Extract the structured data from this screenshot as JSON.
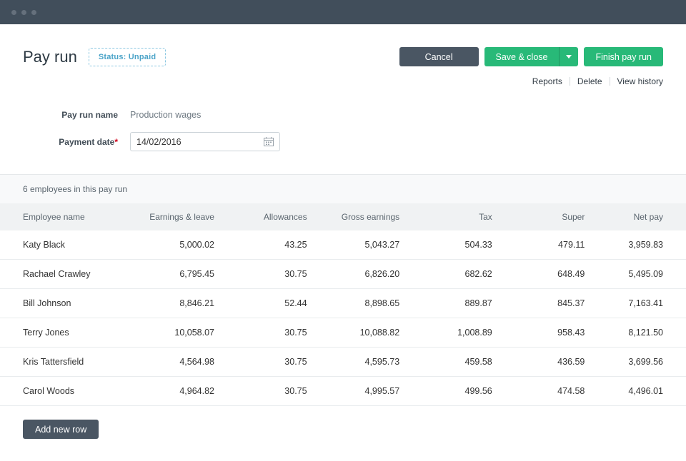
{
  "colors": {
    "topbar": "#414e5b",
    "dot": "#65707c",
    "dark_button": "#4a5663",
    "green": "#28b978",
    "badge_text": "#4aa3c8",
    "badge_border": "#8cc8e1",
    "link": "#333d46",
    "red": "#d0021b",
    "table_header_bg": "#f0f2f3"
  },
  "header": {
    "title": "Pay run",
    "status_badge": "Status: Unpaid",
    "buttons": {
      "cancel": "Cancel",
      "save_close": "Save & close",
      "finish": "Finish pay run"
    },
    "links": [
      "Reports",
      "Delete",
      "View history"
    ]
  },
  "form": {
    "name_label": "Pay run name",
    "name_value": "Production wages",
    "date_label": "Payment date",
    "required_marker": "*",
    "date_value": "14/02/2016"
  },
  "table": {
    "summary": "6 employees in this pay run",
    "columns": [
      "Employee name",
      "Earnings & leave",
      "Allowances",
      "Gross earnings",
      "Tax",
      "Super",
      "Net pay"
    ],
    "rows": [
      [
        "Katy Black",
        "5,000.02",
        "43.25",
        "5,043.27",
        "504.33",
        "479.11",
        "3,959.83"
      ],
      [
        "Rachael Crawley",
        "6,795.45",
        "30.75",
        "6,826.20",
        "682.62",
        "648.49",
        "5,495.09"
      ],
      [
        "Bill Johnson",
        "8,846.21",
        "52.44",
        "8,898.65",
        "889.87",
        "845.37",
        "7,163.41"
      ],
      [
        "Terry Jones",
        "10,058.07",
        "30.75",
        "10,088.82",
        "1,008.89",
        "958.43",
        "8,121.50"
      ],
      [
        "Kris Tattersfield",
        "4,564.98",
        "30.75",
        "4,595.73",
        "459.58",
        "436.59",
        "3,699.56"
      ],
      [
        "Carol Woods",
        "4,964.82",
        "30.75",
        "4,995.57",
        "499.56",
        "474.58",
        "4,496.01"
      ]
    ],
    "add_row_label": "Add new row"
  }
}
